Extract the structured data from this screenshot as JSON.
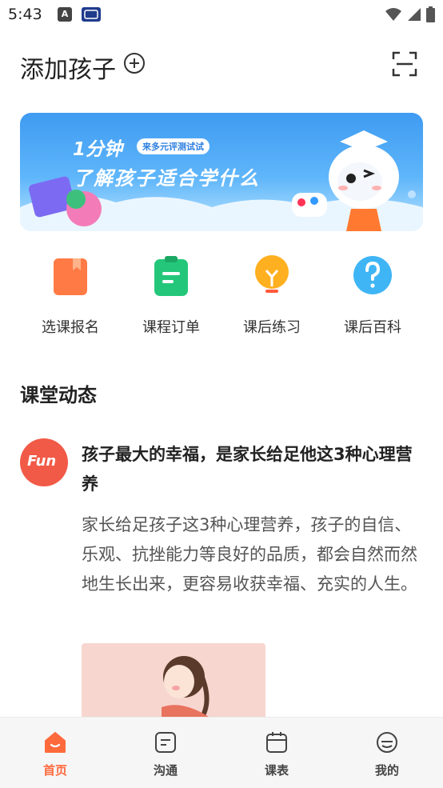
{
  "status_bar": {
    "time": "5:43",
    "notif_a": "A"
  },
  "header": {
    "title": "添加孩子"
  },
  "banner": {
    "headline": "1分钟",
    "badge": "来多元评测试试",
    "subheadline": "了解孩子适合学什么"
  },
  "quick_actions": [
    {
      "label": "选课报名",
      "icon": "bookmark-icon",
      "color": "#ff7a45"
    },
    {
      "label": "课程订单",
      "icon": "clipboard-icon",
      "color": "#24c77a"
    },
    {
      "label": "课后练习",
      "icon": "lightbulb-icon",
      "color": "#ffb020"
    },
    {
      "label": "课后百科",
      "icon": "question-bubble-icon",
      "color": "#3fb5f5"
    }
  ],
  "feed": {
    "section_title": "课堂动态",
    "post": {
      "avatar_text": "Fun",
      "title": "孩子最大的幸福，是家长给足他这3种心理营养",
      "body": "家长给足孩子这3种心理营养，孩子的自信、乐观、抗挫能力等良好的品质，都会自然而然地生长出来，更容易收获幸福、充实的人生。"
    }
  },
  "tabs": [
    {
      "label": "首页",
      "icon": "home-icon",
      "active": true
    },
    {
      "label": "沟通",
      "icon": "message-icon",
      "active": false
    },
    {
      "label": "课表",
      "icon": "calendar-icon",
      "active": false
    },
    {
      "label": "我的",
      "icon": "profile-icon",
      "active": false
    }
  ],
  "colors": {
    "accent": "#ff6a3d",
    "banner_blue": "#3f9bf2",
    "avatar_red": "#f15a47"
  }
}
